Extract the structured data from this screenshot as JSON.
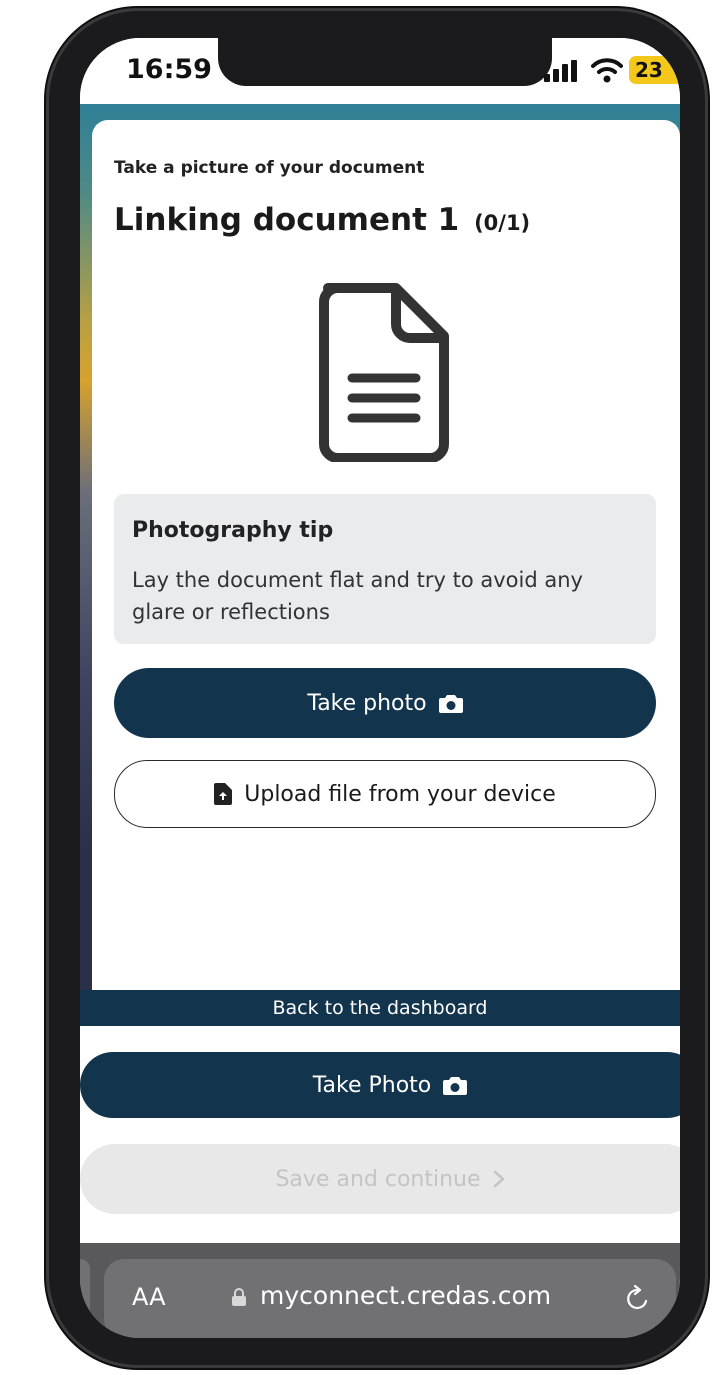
{
  "status_bar": {
    "time": "16:59",
    "battery": "23"
  },
  "page": {
    "eyebrow": "Take a picture of your document",
    "title": "Linking document 1",
    "title_count": "(0/1)",
    "icons": {
      "document": "document-icon"
    }
  },
  "tip": {
    "title": "Photography tip",
    "text": "Lay the document flat and try to avoid any glare or reflections"
  },
  "actions": {
    "take_photo": "Take photo",
    "upload": "Upload file from your device",
    "back": "Back to the dashboard",
    "take_photo_bottom": "Take Photo",
    "save_continue": "Save and continue"
  },
  "browser": {
    "aa": "AA",
    "url": "myconnect.credas.com"
  },
  "colors": {
    "primary": "#12344d",
    "tip_bg": "#e9ebec",
    "disabled_bg": "#e8e8e8",
    "disabled_text": "#c4c4c4",
    "battery": "#f4c81a",
    "browser_bar": "#59595b"
  }
}
